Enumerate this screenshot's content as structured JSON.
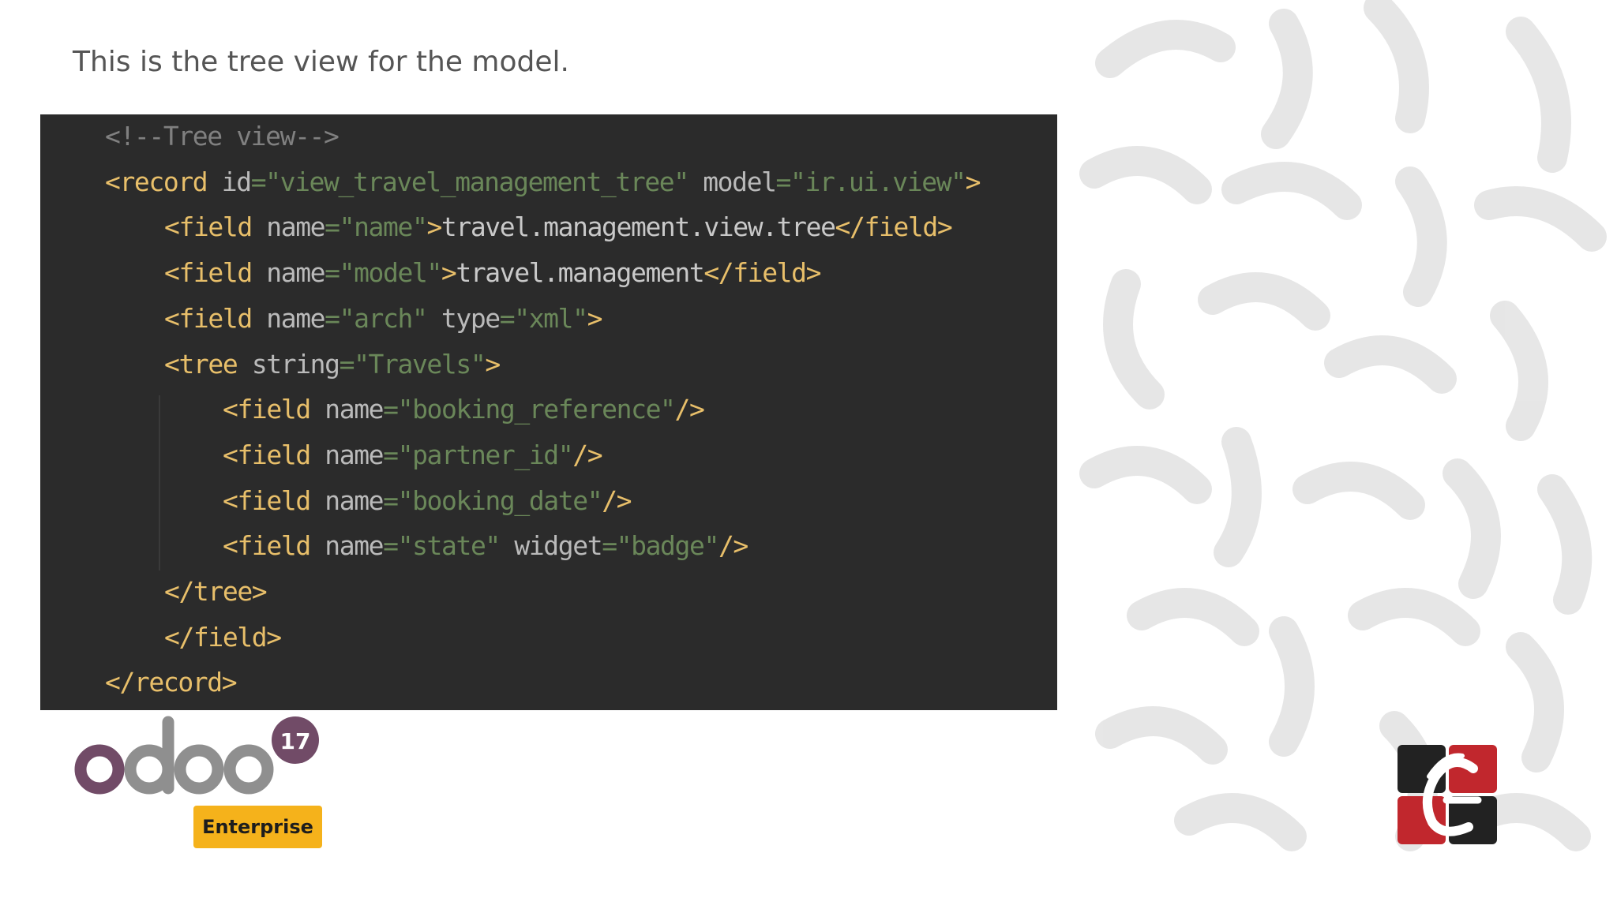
{
  "caption": "This is the tree view for the model.",
  "code": {
    "lines": [
      {
        "indent": 0,
        "tokens": [
          {
            "t": "<!--Tree view-->",
            "k": "comment"
          }
        ]
      },
      {
        "indent": 0,
        "tokens": [
          {
            "t": "<record ",
            "k": "tag"
          },
          {
            "t": "id",
            "k": "attr"
          },
          {
            "t": "=",
            "k": "eq"
          },
          {
            "t": "\"view_travel_management_tree\"",
            "k": "str"
          },
          {
            "t": " model",
            "k": "attr"
          },
          {
            "t": "=",
            "k": "eq"
          },
          {
            "t": "\"ir.ui.view\"",
            "k": "str"
          },
          {
            "t": ">",
            "k": "tag"
          }
        ]
      },
      {
        "indent": 1,
        "tokens": [
          {
            "t": "<field ",
            "k": "tag"
          },
          {
            "t": "name",
            "k": "attr"
          },
          {
            "t": "=",
            "k": "eq"
          },
          {
            "t": "\"name\"",
            "k": "str"
          },
          {
            "t": ">",
            "k": "tag"
          },
          {
            "t": "travel.management.view.tree",
            "k": "text"
          },
          {
            "t": "</field>",
            "k": "tag"
          }
        ]
      },
      {
        "indent": 1,
        "tokens": [
          {
            "t": "<field ",
            "k": "tag"
          },
          {
            "t": "name",
            "k": "attr"
          },
          {
            "t": "=",
            "k": "eq"
          },
          {
            "t": "\"model\"",
            "k": "str"
          },
          {
            "t": ">",
            "k": "tag"
          },
          {
            "t": "travel.management",
            "k": "text"
          },
          {
            "t": "</field>",
            "k": "tag"
          }
        ]
      },
      {
        "indent": 1,
        "tokens": [
          {
            "t": "<field ",
            "k": "tag"
          },
          {
            "t": "name",
            "k": "attr"
          },
          {
            "t": "=",
            "k": "eq"
          },
          {
            "t": "\"arch\"",
            "k": "str"
          },
          {
            "t": " type",
            "k": "attr"
          },
          {
            "t": "=",
            "k": "eq"
          },
          {
            "t": "\"xml\"",
            "k": "str"
          },
          {
            "t": ">",
            "k": "tag"
          }
        ]
      },
      {
        "indent": 1,
        "tokens": [
          {
            "t": "<tree ",
            "k": "tag"
          },
          {
            "t": "string",
            "k": "attr"
          },
          {
            "t": "=",
            "k": "eq"
          },
          {
            "t": "\"Travels\"",
            "k": "str"
          },
          {
            "t": ">",
            "k": "tag"
          }
        ]
      },
      {
        "indent": 2,
        "tokens": [
          {
            "t": "<field ",
            "k": "tag"
          },
          {
            "t": "name",
            "k": "attr"
          },
          {
            "t": "=",
            "k": "eq"
          },
          {
            "t": "\"booking_reference\"",
            "k": "str"
          },
          {
            "t": "/>",
            "k": "tag"
          }
        ]
      },
      {
        "indent": 2,
        "tokens": [
          {
            "t": "<field ",
            "k": "tag"
          },
          {
            "t": "name",
            "k": "attr"
          },
          {
            "t": "=",
            "k": "eq"
          },
          {
            "t": "\"partner_id\"",
            "k": "str"
          },
          {
            "t": "/>",
            "k": "tag"
          }
        ]
      },
      {
        "indent": 2,
        "tokens": [
          {
            "t": "<field ",
            "k": "tag"
          },
          {
            "t": "name",
            "k": "attr"
          },
          {
            "t": "=",
            "k": "eq"
          },
          {
            "t": "\"booking_date\"",
            "k": "str"
          },
          {
            "t": "/>",
            "k": "tag"
          }
        ]
      },
      {
        "indent": 2,
        "tokens": [
          {
            "t": "<field ",
            "k": "tag"
          },
          {
            "t": "name",
            "k": "attr"
          },
          {
            "t": "=",
            "k": "eq"
          },
          {
            "t": "\"state\"",
            "k": "str"
          },
          {
            "t": " widget",
            "k": "attr"
          },
          {
            "t": "=",
            "k": "eq"
          },
          {
            "t": "\"badge\"",
            "k": "str"
          },
          {
            "t": "/>",
            "k": "tag"
          }
        ]
      },
      {
        "indent": 1,
        "tokens": [
          {
            "t": "</tree>",
            "k": "tag"
          }
        ]
      },
      {
        "indent": 1,
        "tokens": [
          {
            "t": "</field>",
            "k": "tag"
          }
        ]
      },
      {
        "indent": 0,
        "tokens": [
          {
            "t": "</record>",
            "k": "tag"
          }
        ]
      }
    ]
  },
  "branding": {
    "odoo_word": "odoo",
    "version_badge": "17",
    "edition_label": "Enterprise",
    "colors": {
      "odoo_purple": "#714b67",
      "odoo_grey": "#8f8f8f",
      "enterprise_yellow": "#f5b21b",
      "cy_red": "#c1272d",
      "cy_dark": "#222222"
    }
  }
}
